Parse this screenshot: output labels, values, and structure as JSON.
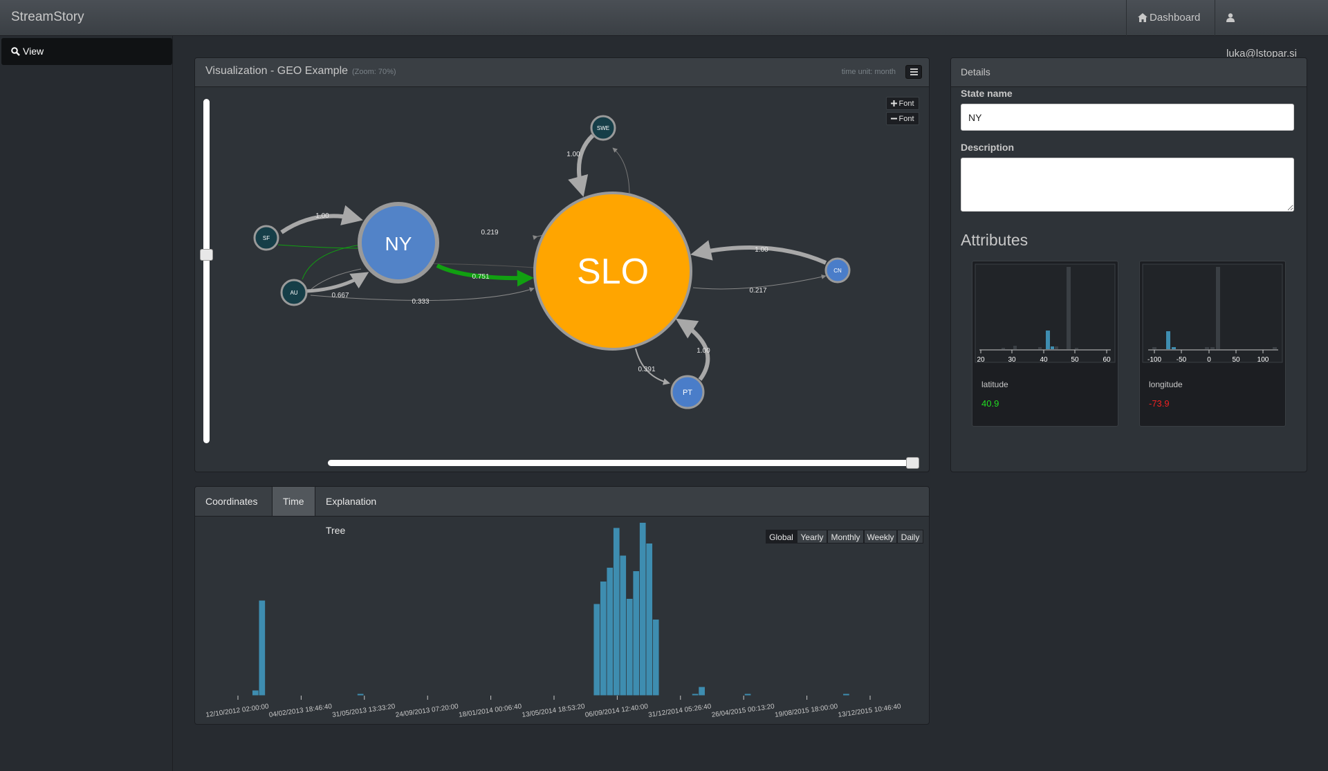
{
  "navbar": {
    "brand": "StreamStory",
    "dashboard_label": "Dashboard",
    "user_label": "luka@lstopar.si"
  },
  "sidebar": {
    "items": [
      {
        "label": "View",
        "icon": "search-icon"
      }
    ]
  },
  "visualization": {
    "title": "Visualization - GEO Example",
    "zoom_label": "(Zoom: 70%)",
    "time_unit_label": "time unit: month",
    "font_plus_label": "Font",
    "font_minus_label": "Font",
    "vertical_slider_value": 0.45,
    "horizontal_slider_value": 1.0,
    "states": [
      {
        "id": "SLO",
        "label": "SLO",
        "color": "#ffa500"
      },
      {
        "id": "NY",
        "label": "NY",
        "color": "#5283c8",
        "selected": true
      },
      {
        "id": "SWE",
        "label": "SWE",
        "color": "#163e48"
      },
      {
        "id": "SF",
        "label": "SF",
        "color": "#163e48"
      },
      {
        "id": "AU",
        "label": "AU",
        "color": "#163e48"
      },
      {
        "id": "CN",
        "label": "CN",
        "color": "#4a7dc9"
      },
      {
        "id": "PT",
        "label": "PT",
        "color": "#4a7dc9"
      }
    ],
    "transitions": [
      {
        "from": "SF",
        "to": "NY",
        "label": "1.00"
      },
      {
        "from": "SWE",
        "to": "SLO",
        "label": "1.00"
      },
      {
        "from": "SLO",
        "to": "NY",
        "label": "0.219"
      },
      {
        "from": "NY",
        "to": "SLO",
        "label": "0.751",
        "highlight": true
      },
      {
        "from": "AU",
        "to": "NY",
        "label": "0.667"
      },
      {
        "from": "AU",
        "to": "SLO",
        "label": "0.333"
      },
      {
        "from": "CN",
        "to": "SLO",
        "label": "1.00"
      },
      {
        "from": "SLO",
        "to": "CN",
        "label": "0.217"
      },
      {
        "from": "PT",
        "to": "SLO",
        "label": "1.00"
      },
      {
        "from": "SLO",
        "to": "PT",
        "label": "0.391"
      }
    ]
  },
  "details": {
    "title": "Details",
    "state_name_label": "State name",
    "state_name_value": "NY",
    "description_label": "Description",
    "description_value": "",
    "attributes_title": "Attributes",
    "attributes": [
      {
        "name": "latitude",
        "value": "40.9",
        "value_color": "#22dd22",
        "ticks": [
          "20",
          "30",
          "40",
          "50",
          "60"
        ]
      },
      {
        "name": "longitude",
        "value": "-73.9",
        "value_color": "#ee2222",
        "ticks": [
          "-100",
          "-50",
          "0",
          "50",
          "100"
        ]
      }
    ]
  },
  "bottom_panel": {
    "tabs": [
      "Coordinates",
      "Time",
      "Explanation Tree"
    ],
    "active_tab": "Time",
    "periods": [
      "Global",
      "Yearly",
      "Monthly",
      "Weekly",
      "Daily"
    ],
    "active_period": "Global"
  },
  "chart_data": {
    "type": "bar",
    "title": "",
    "xlabel": "",
    "ylabel": "",
    "bar_color": "#3e8db0",
    "x_ticks": [
      "12/10/2012 02:00:00",
      "04/02/2013 18:46:40",
      "31/05/2013 13:33:20",
      "24/09/2013 07:20:00",
      "18/01/2014 00:06:40",
      "13/05/2014 18:53:20",
      "06/09/2014 12:40:00",
      "31/12/2014 05:26:40",
      "26/04/2015 00:13:20",
      "19/08/2015 18:00:00",
      "13/12/2015 10:46:40"
    ],
    "ylim": [
      0,
      100
    ],
    "values": [
      3,
      55,
      0,
      0,
      0,
      0,
      0,
      0,
      0,
      0,
      0,
      0,
      0,
      0,
      0,
      0,
      1,
      0,
      0,
      0,
      0,
      0,
      0,
      0,
      0,
      0,
      0,
      0,
      0,
      0,
      0,
      0,
      0,
      0,
      0,
      0,
      0,
      0,
      0,
      0,
      0,
      0,
      0,
      0,
      0,
      0,
      0,
      0,
      0,
      0,
      0,
      0,
      53,
      66,
      74,
      97,
      81,
      56,
      72,
      100,
      88,
      44,
      0,
      0,
      0,
      0,
      0,
      1,
      5,
      0,
      0,
      0,
      0,
      0,
      0,
      1,
      0,
      0,
      0,
      0,
      0,
      0,
      0,
      0,
      0,
      0,
      0,
      0,
      0,
      0,
      1,
      0,
      0,
      0,
      0,
      0
    ]
  }
}
